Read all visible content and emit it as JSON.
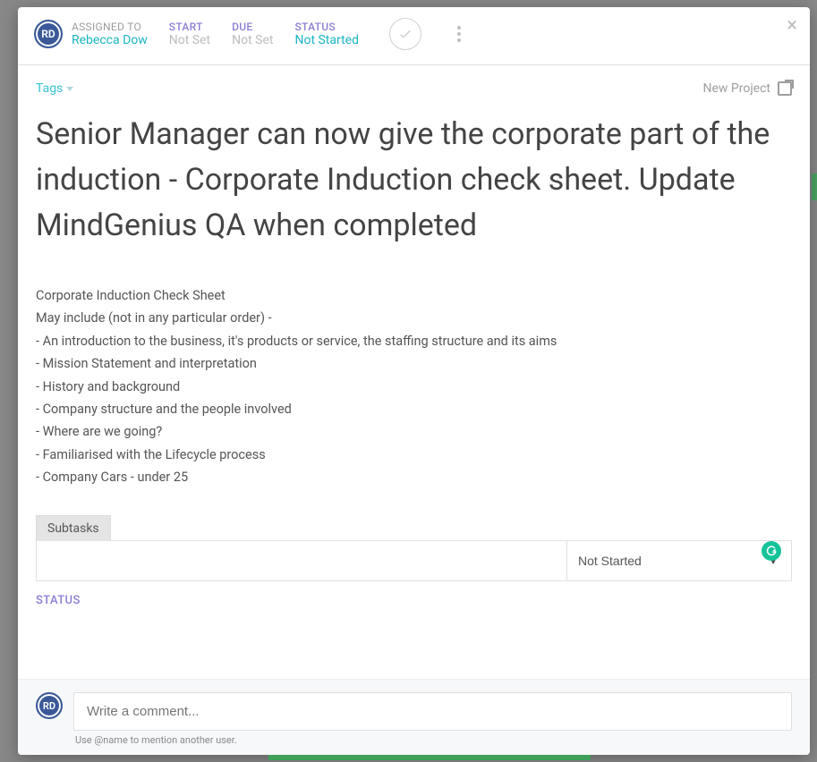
{
  "header": {
    "avatar_initials": "RD",
    "assigned_label": "ASSIGNED TO",
    "assigned_value": "Rebecca Dow",
    "start_label": "START",
    "start_value": "Not Set",
    "due_label": "DUE",
    "due_value": "Not Set",
    "status_label": "STATUS",
    "status_value": "Not Started"
  },
  "toprow": {
    "tags_label": "Tags",
    "project_label": "New Project"
  },
  "task": {
    "title": "Senior Manager can now give the corporate part of the induction - Corporate Induction check sheet. Update MindGenius QA when completed",
    "description_lines": [
      "Corporate Induction Check Sheet",
      "May include (not in any particular order) -",
      "- An introduction to the business, it's products or service, the staffing structure and its aims",
      "- Mission Statement and interpretation",
      "- History and background",
      "- Company structure and the people involved",
      "- Where are we going?",
      "- Familiarised with the Lifecycle process",
      "- Company Cars - under 25"
    ]
  },
  "subtasks": {
    "tab_label": "Subtasks",
    "row_status": "Not Started"
  },
  "status_section_label": "STATUS",
  "footer": {
    "avatar_initials": "RD",
    "comment_placeholder": "Write a comment...",
    "hint": "Use @name to mention another user."
  },
  "grammarly_glyph": "G"
}
